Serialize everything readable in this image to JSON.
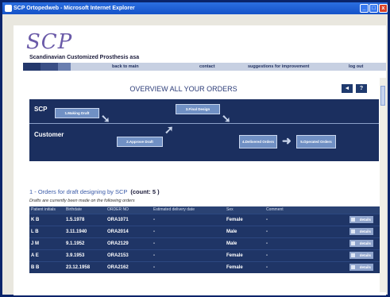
{
  "window": {
    "title": "SCP Ortopedweb - Microsoft Internet Explorer",
    "min": "_",
    "max": "□",
    "close": "x"
  },
  "logo": {
    "mark": "SCP",
    "tagline": "Scandinavian Customized Prosthesis asa"
  },
  "nav": {
    "back": "back to main",
    "contact": "contact",
    "suggestions": "suggestions for improvement",
    "logout": "log out"
  },
  "page": {
    "title": "OVERVIEW ALL YOUR ORDERS",
    "btn_back": "◄",
    "btn_help": "?"
  },
  "workflow": {
    "lane_scp": "SCP",
    "lane_customer": "Customer",
    "steps": [
      "1.Making Draft",
      "2.Approve Draft",
      "3.Final Design",
      "4.Delivered Orders",
      "5.Operated Orders"
    ]
  },
  "section": {
    "title": "1 - Orders for draft designing by SCP",
    "count": "(count: 5 )",
    "subtitle": "Drafts are currently been made on the following orders"
  },
  "table": {
    "headers": [
      "Patient initials",
      "Birthdate",
      "ORDER NO",
      "Estimated delivery date",
      "Sex",
      "Comment",
      ""
    ],
    "details_label": "details",
    "rows": [
      [
        "K B",
        "1.5.1978",
        "ORA1071",
        "-",
        "Female",
        "-"
      ],
      [
        "L B",
        "3.11.1940",
        "ORA2014",
        "-",
        "Male",
        "-"
      ],
      [
        "J M",
        "9.1.1952",
        "ORA2129",
        "-",
        "Male",
        "-"
      ],
      [
        "A E",
        "3.9.1953",
        "ORA2153",
        "-",
        "Female",
        "-"
      ],
      [
        "B B",
        "23.12.1958",
        "ORA2162",
        "-",
        "Female",
        "-"
      ]
    ]
  }
}
